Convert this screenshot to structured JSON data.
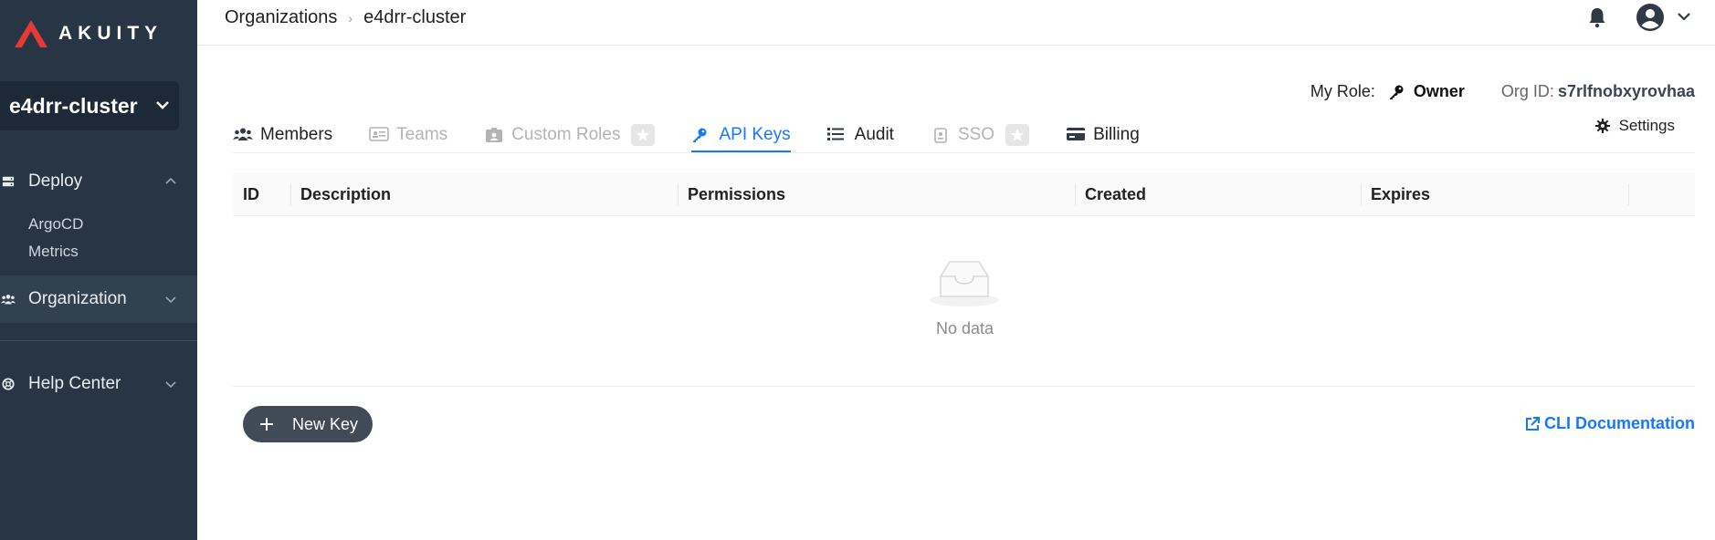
{
  "brand": {
    "name": "AKUITY",
    "color": "#e53935"
  },
  "sidebar": {
    "cluster": "e4drr-cluster",
    "deploy": {
      "label": "Deploy",
      "icon": "server-icon"
    },
    "deploy_items": [
      {
        "label": "ArgoCD"
      },
      {
        "label": "Metrics"
      }
    ],
    "organization": {
      "label": "Organization",
      "icon": "users-icon"
    },
    "help": {
      "label": "Help Center",
      "icon": "lifebuoy-icon"
    }
  },
  "header": {
    "breadcrumb": [
      "Organizations",
      "e4drr-cluster"
    ]
  },
  "role": {
    "label": "My Role:",
    "value": "Owner",
    "org_label": "Org ID:",
    "org_id": "s7rlfnobxyrovhaa"
  },
  "tabs": [
    {
      "label": "Members",
      "icon": "users-icon",
      "state": "normal"
    },
    {
      "label": "Teams",
      "icon": "id-card-icon",
      "state": "disabled"
    },
    {
      "label": "Custom Roles",
      "icon": "badge-icon",
      "state": "disabled"
    },
    {
      "label": "API Keys",
      "icon": "key-icon",
      "state": "active"
    },
    {
      "label": "Audit",
      "icon": "list-icon",
      "state": "normal"
    },
    {
      "label": "SSO",
      "icon": "badge-icon",
      "state": "disabled"
    },
    {
      "label": "Billing",
      "icon": "credit-card-icon",
      "state": "normal"
    }
  ],
  "settings_label": "Settings",
  "table": {
    "columns": [
      "ID",
      "Description",
      "Permissions",
      "Created",
      "Expires"
    ],
    "empty_text": "No data"
  },
  "actions": {
    "new_key": "New Key",
    "cli_doc": "CLI Documentation"
  },
  "colors": {
    "sidebar": "#273544",
    "accent": "#1677ff",
    "button": "#414b57"
  }
}
